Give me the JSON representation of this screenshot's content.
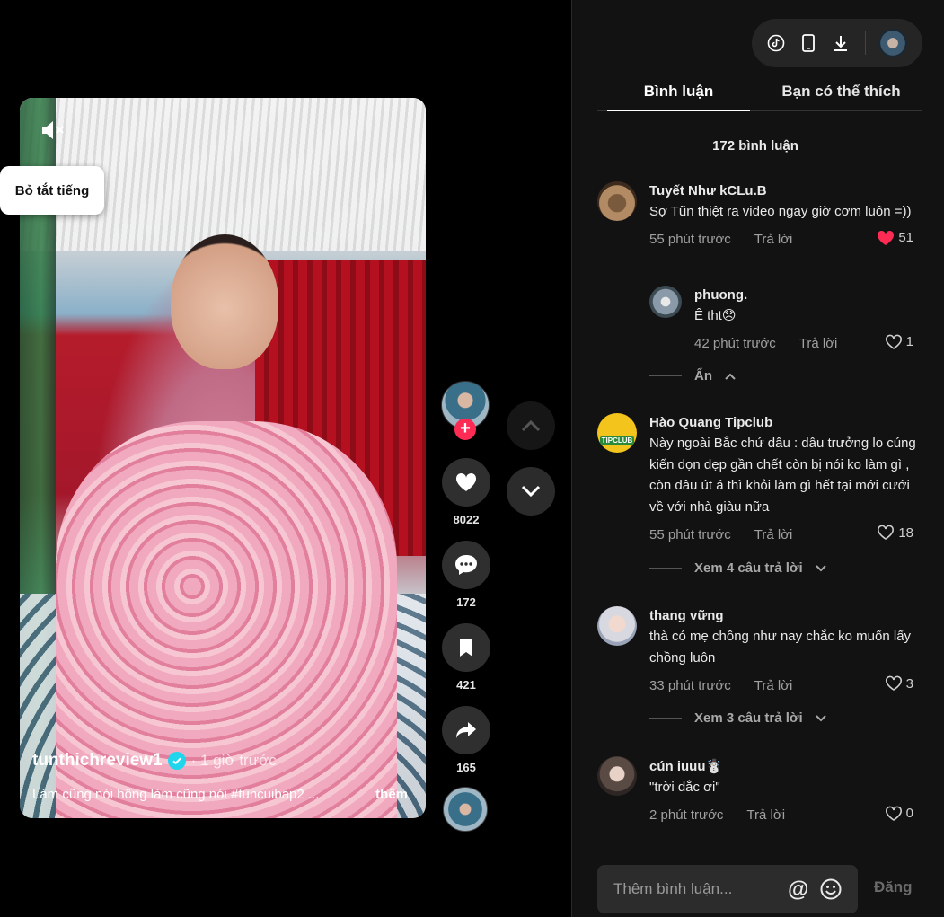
{
  "video": {
    "mute_tooltip": "Bỏ tắt tiếng",
    "author": "tunthichreview1",
    "time": "· 1 giờ trước",
    "caption": "Làm cũng nói hông làm cũng nói #tuncuibap2 ...",
    "more": "thêm"
  },
  "actions": {
    "likes": "8022",
    "comments": "172",
    "saves": "421",
    "shares": "165"
  },
  "panel": {
    "tabs": [
      "Bình luận",
      "Bạn có thể thích"
    ],
    "comment_count": "172 bình luận",
    "reply_label": "Trả lời",
    "input_placeholder": "Thêm bình luận...",
    "post_label": "Đăng"
  },
  "comments": [
    {
      "user": "Tuyết Như kCLu.B",
      "text": "Sợ Tũn thiệt ra video ngay giờ cơm luôn =))",
      "time": "55 phút trước",
      "likes": "51",
      "liked": true
    },
    {
      "user": "phuong.",
      "text": "Ê tht😞",
      "time": "42 phút trước",
      "likes": "1",
      "liked": false
    },
    {
      "user": "Hào Quang Tipclub",
      "text": "Này ngoài Bắc chứ dâu : dâu trưởng lo cúng kiến dọn dẹp gần chết còn bị nói ko làm gì , còn dâu út á thì khỏi làm gì hết tại mới cưới về với nhà giàu nữa",
      "time": "55 phút trước",
      "likes": "18",
      "liked": false
    },
    {
      "user": "thang vững",
      "text": "thà có mẹ chồng như nay chắc ko muốn lấy chồng luôn",
      "time": "33 phút trước",
      "likes": "3",
      "liked": false
    },
    {
      "user": "cún iuuu☃️",
      "text": "\"trời dắc ơi\"",
      "time": "2 phút trước",
      "likes": "0",
      "liked": false
    }
  ],
  "toggles": {
    "hide": "Ẩn",
    "view_4": "Xem 4 câu trả lời",
    "view_3": "Xem 3 câu trả lời"
  },
  "avatar_badge": "TIPCLUB",
  "colors": {
    "accent": "#fe2c55",
    "verified": "#20d5ec",
    "tipclub": "#f3c41c"
  }
}
